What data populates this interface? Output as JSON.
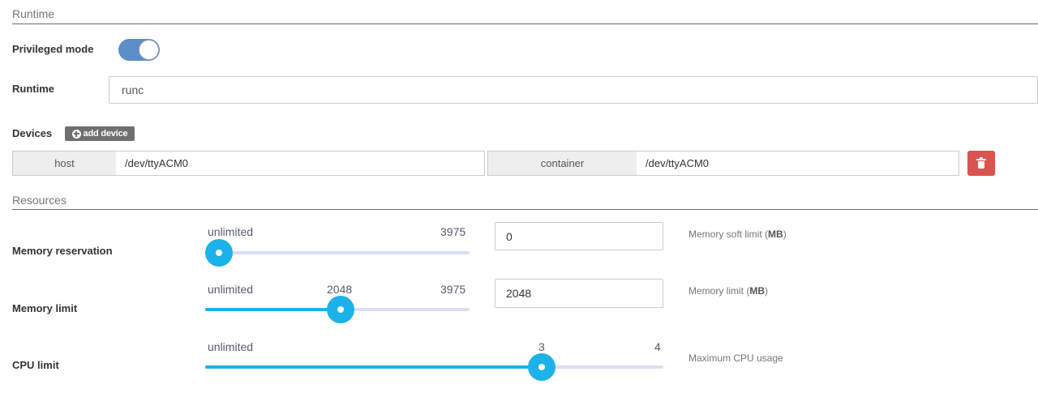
{
  "runtime_section": {
    "title": "Runtime",
    "privileged_mode": {
      "label": "Privileged mode",
      "enabled": true
    },
    "runtime": {
      "label": "Runtime",
      "value": "runc"
    }
  },
  "devices": {
    "label": "Devices",
    "add_button": "add device",
    "items": [
      {
        "host_label": "host",
        "host_value": "/dev/ttyACM0",
        "container_label": "container",
        "container_value": "/dev/ttyACM0"
      }
    ]
  },
  "resources": {
    "title": "Resources",
    "memory_reservation": {
      "label": "Memory reservation",
      "min_label": "unlimited",
      "max_label": "3975",
      "min": 0,
      "max": 3975,
      "value": 0,
      "input_value": "0",
      "help_prefix": "Memory soft limit (",
      "help_unit": "MB",
      "help_suffix": ")"
    },
    "memory_limit": {
      "label": "Memory limit",
      "min_label": "unlimited",
      "max_label": "3975",
      "value_label": "2048",
      "min": 0,
      "max": 3975,
      "value": 2048,
      "input_value": "2048",
      "help_prefix": "Memory limit (",
      "help_unit": "MB",
      "help_suffix": ")"
    },
    "cpu_limit": {
      "label": "CPU limit",
      "min_label": "unlimited",
      "max_label": "4",
      "value_label": "3",
      "min": 0,
      "max": 4,
      "value": 3,
      "help": "Maximum CPU usage"
    }
  },
  "colors": {
    "slider_accent": "#1cb1e8",
    "toggle_on": "#5b8ec8",
    "danger": "#d9534f"
  },
  "icons": {
    "add": "plus-circle-icon",
    "remove": "trash-icon"
  }
}
